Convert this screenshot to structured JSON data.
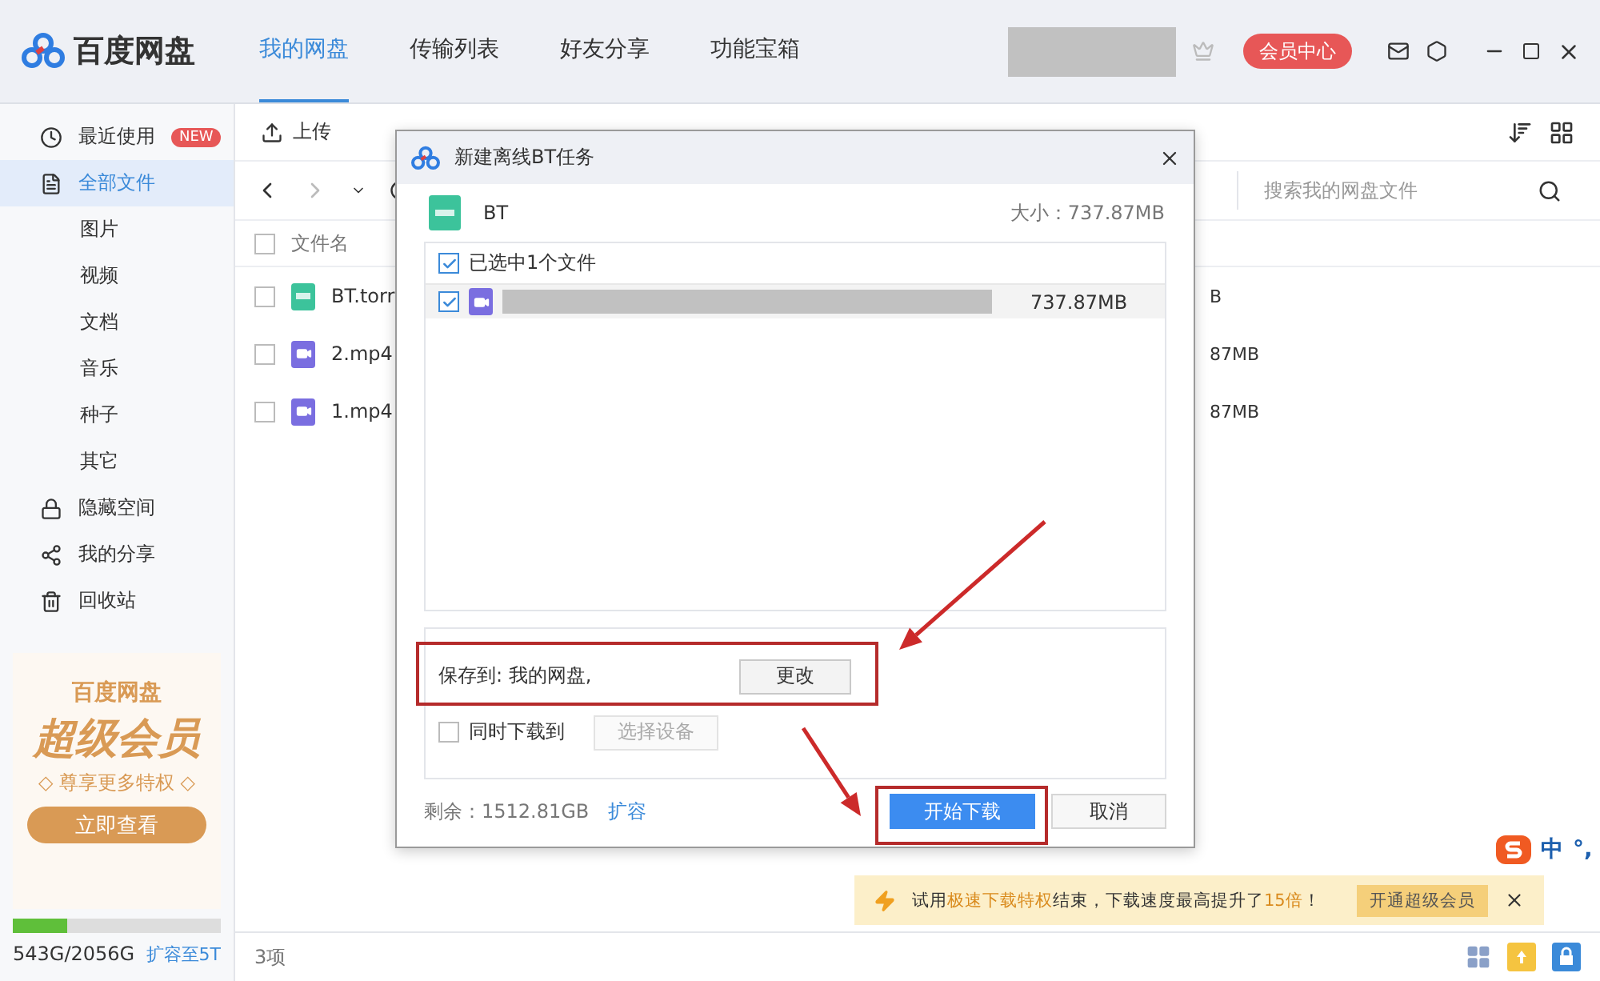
{
  "app": {
    "title": "百度网盘"
  },
  "nav_tabs": [
    {
      "label": "我的网盘",
      "selected": true
    },
    {
      "label": "传输列表",
      "selected": false
    },
    {
      "label": "好友分享",
      "selected": false
    },
    {
      "label": "功能宝箱",
      "selected": false
    }
  ],
  "header": {
    "vip_button": "会员中心"
  },
  "sidebar": {
    "items": [
      {
        "label": "最近使用",
        "badge": "NEW",
        "selected": false
      },
      {
        "label": "全部文件",
        "selected": true,
        "children": [
          {
            "label": "图片",
            "selected": false
          },
          {
            "label": "视频",
            "selected": false
          },
          {
            "label": "文档",
            "selected": false
          },
          {
            "label": "音乐",
            "selected": false
          },
          {
            "label": "种子",
            "selected": false
          },
          {
            "label": "其它",
            "selected": false
          }
        ]
      },
      {
        "label": "隐藏空间",
        "selected": false
      },
      {
        "label": "我的分享",
        "selected": false
      },
      {
        "label": "回收站",
        "selected": false
      }
    ]
  },
  "promo": {
    "brand": "百度网盘",
    "headline": "超级会员",
    "tagline": "◇ 尊享更多特权 ◇",
    "button": "立即查看"
  },
  "storage": {
    "level": 0.26,
    "usage": "543G/2056G",
    "link": "扩容至5T"
  },
  "toolbar": {
    "actions": [
      "上传"
    ]
  },
  "search": {
    "placeholder": "搜索我的网盘文件"
  },
  "file_table": {
    "columns": [
      "文件名"
    ],
    "all_checked": false,
    "rows": [
      {
        "name": "BT.torr",
        "kind": "torrent",
        "checked": false,
        "column_2": "B"
      },
      {
        "name": "2.mp4",
        "kind": "video",
        "checked": false,
        "column_2": "87MB"
      },
      {
        "name": "1.mp4",
        "kind": "video",
        "checked": false,
        "column_2": "87MB"
      }
    ]
  },
  "status_bar": {
    "count": "3项"
  },
  "notice": {
    "parts": [
      {
        "text": "试用",
        "highlight": false
      },
      {
        "text": "极速下载特权",
        "highlight": true
      },
      {
        "text": "结束，下载速度最高提升了",
        "highlight": false
      },
      {
        "text": "15倍",
        "highlight": true
      },
      {
        "text": "！",
        "highlight": false
      }
    ],
    "button": "开通超级会员"
  },
  "ime": {
    "mode": "中",
    "punct": "°,"
  },
  "dialog": {
    "title": "新建离线BT任务",
    "file": {
      "name": "BT",
      "size": "大小：737.87MB"
    },
    "select_all": {
      "label": "已选中1个文件",
      "checked": true
    },
    "files": [
      {
        "checked": true,
        "size": "737.87MB"
      }
    ],
    "save_to": "保存到: 我的网盘,",
    "change_button": "更改",
    "also_download": {
      "label": "同时下载到",
      "checked": false
    },
    "device_button": "选择设备",
    "remaining": "剩余：1512.81GB",
    "expand_link": "扩容",
    "start_button": "开始下载",
    "cancel_button": "取消"
  }
}
